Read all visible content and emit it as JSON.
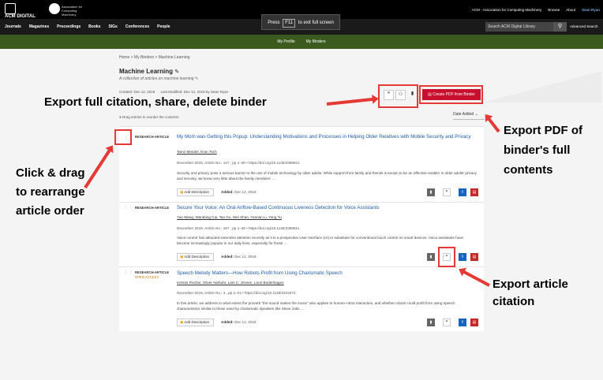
{
  "topbar": {
    "logo_text": "ACM DIGITAL LIBRARY",
    "assoc_text": "Association for Computing Machinery",
    "fullscreen_msg_pre": "Press",
    "fullscreen_key": "F11",
    "fullscreen_msg_post": "to exit full screen",
    "links": [
      "ACM - Association for Computing Machinery",
      "Browse",
      "About"
    ],
    "user": "Sean Ryan"
  },
  "nav": {
    "items": [
      "Journals",
      "Magazines",
      "Proceedings",
      "Books",
      "SIGs",
      "Conferences",
      "People"
    ],
    "search_placeholder": "Search ACM Digital Library",
    "advanced": "Advanced Search"
  },
  "subnav": {
    "items": [
      "My Profile",
      "My Binders"
    ]
  },
  "page": {
    "breadcrumb": "Home > My Binders > Machine Learning",
    "title": "Machine Learning",
    "subtitle": "A collection of articles on machine learning",
    "created": "Created: Dec 12, 2019",
    "modified": "Last Modified: Dec 12, 2019 by Sean Ryan",
    "pdf_button": "Create PDF from Binder",
    "sort": "Date Added",
    "drag_hint": "Drag entries to reorder the contents."
  },
  "articles": [
    {
      "type": "RESEARCH-ARTICLE",
      "title": "My Mom was Getting this Popup: Understanding Motivations and Processes in Helping Older Relatives with Mobile Security and Privacy",
      "authors": "Tamir Mendel, Eran Toch",
      "meta": "December 2019, Article No.: 147 , pp 1–20 • https://doi.org/10.1145/3369821",
      "abstract": "Security and privacy pose a serious barrier to the use of mobile technology by older adults. While support from family and friends is known to be an effective enabler in older adults' privacy and security, we know very little about the family members' ...",
      "add_desc": "Add Description",
      "added_label": "Added:",
      "added_date": "Dec 12, 2019"
    },
    {
      "type": "RESEARCH-ARTICLE",
      "title": "Secure Your Voice: An Oral Airflow-Based Continuous Liveness Detection for Voice Assistants",
      "authors": "Yao Wang, Wandong Cai, Tao Gu, Wei Shao, Yannan Li, Yong Yu",
      "meta": "December 2019, Article No.: 157 , pp 1–28 • https://doi.org/10.1145/3369811",
      "abstract": "Voice control has attracted extensive attention recently as it is a prospective User Interface (UI) to substitute for conventional touch control on smart devices. Voice assistants have become increasingly popular in our daily lives, especially for those ...",
      "add_desc": "Add Description",
      "added_label": "Added:",
      "added_date": "Dec 12, 2019"
    },
    {
      "type": "RESEARCH-ARTICLE",
      "badge": "OPEN ACCESS",
      "title": "Speech Melody Matters—How Robots Profit from Using Charismatic Speech",
      "authors": "Kerstin Fischer, Oliver Niebuhr, Lars C. Jensen, Leon Bodenhagen",
      "meta": "December 2019, Article No.: 4 , pp 1–21 • https://doi.org/10.1145/3344274",
      "abstract": "In this article, we address to what extent the proverb \"the sound makes the music\" also applies to human–robot interaction, and whether robots could profit from using speech characteristics similar to those used by charismatic speakers like Steve Jobs. ...",
      "add_desc": "Add Description",
      "added_label": "Added:",
      "added_date": "Dec 12, 2019"
    }
  ],
  "annotations": {
    "export_share": "Export full citation, share, delete binder",
    "export_pdf": "Export PDF of binder's full contents",
    "drag": "Click & drag to rearrange article order",
    "export_article": "Export article citation"
  },
  "colors": {
    "accent_red": "#e53935",
    "green_bar": "#3a5a1e",
    "link_blue": "#1e5aa8",
    "pdf_red": "#c8102e"
  }
}
